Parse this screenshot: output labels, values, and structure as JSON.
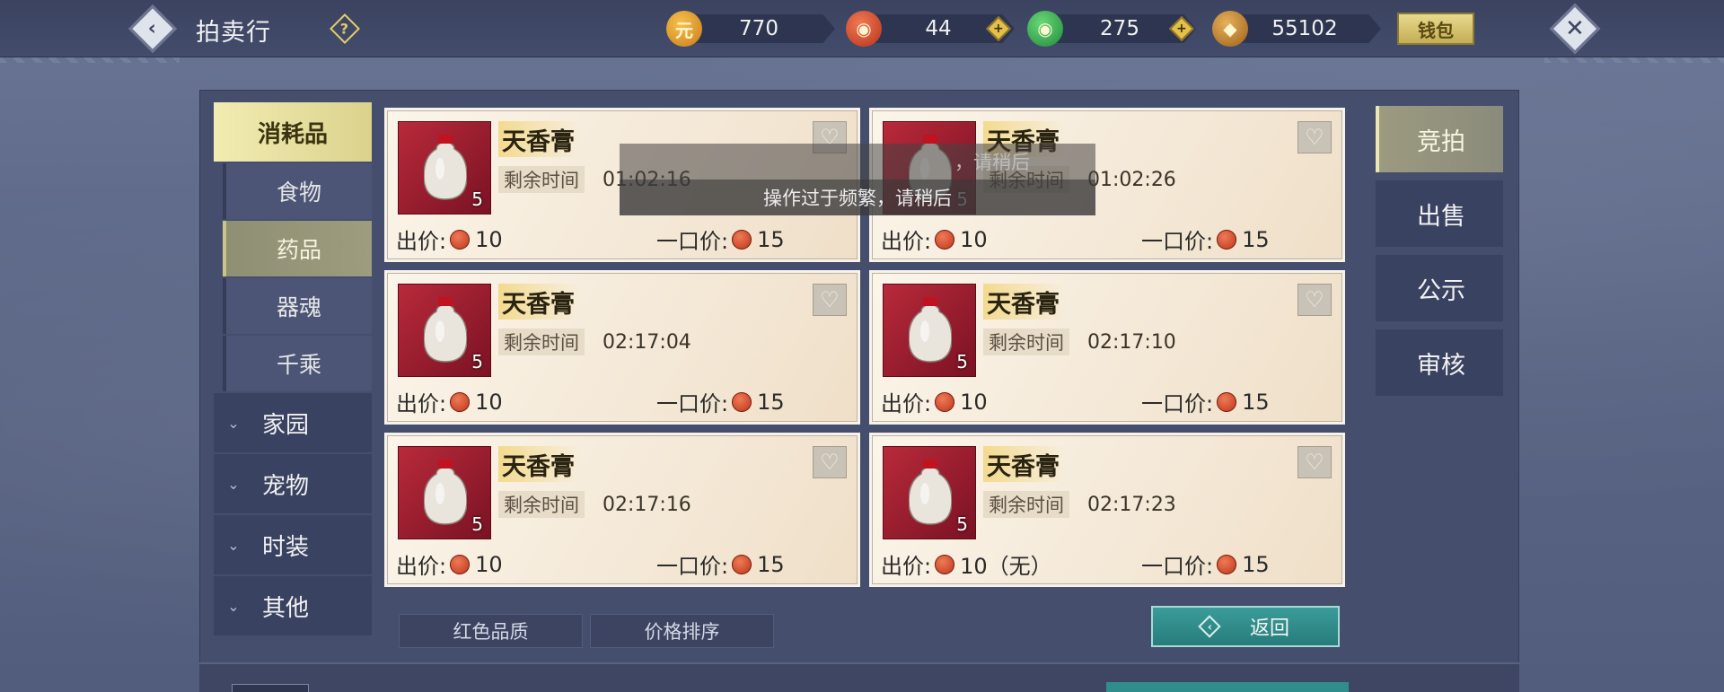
{
  "header": {
    "title": "拍卖行",
    "back_icon": "chevron-left-icon",
    "help_label": "?",
    "wallet_label": "钱包",
    "close_label": "✕"
  },
  "currencies": [
    {
      "name": "gold-ingot",
      "value": "770",
      "color": "#e0a032",
      "has_plus": false
    },
    {
      "name": "red-coin",
      "value": "44",
      "color": "#c9462b",
      "has_plus": true
    },
    {
      "name": "jade-coin",
      "value": "275",
      "color": "#2fa84f",
      "has_plus": true
    },
    {
      "name": "bronze-coin",
      "value": "55102",
      "color": "#b8782a",
      "has_plus": false
    }
  ],
  "categories": {
    "main_active": "消耗品",
    "subs": [
      "食物",
      "药品",
      "器魂",
      "千乘"
    ],
    "active_sub": "药品",
    "others": [
      "家园",
      "宠物",
      "时装",
      "其他"
    ]
  },
  "listings": [
    {
      "name": "天香膏",
      "time_label": "剩余时间",
      "time": "01:02:16",
      "bid_label": "出价:",
      "bid": "10",
      "buyout_label": "一口价:",
      "buyout": "15",
      "qty": "5"
    },
    {
      "name": "天香膏",
      "time_label": "剩余时间",
      "time": "01:02:26",
      "bid_label": "出价:",
      "bid": "10",
      "buyout_label": "一口价:",
      "buyout": "15",
      "qty": "5"
    },
    {
      "name": "天香膏",
      "time_label": "剩余时间",
      "time": "02:17:04",
      "bid_label": "出价:",
      "bid": "10",
      "buyout_label": "一口价:",
      "buyout": "15",
      "qty": "5"
    },
    {
      "name": "天香膏",
      "time_label": "剩余时间",
      "time": "02:17:10",
      "bid_label": "出价:",
      "bid": "10",
      "buyout_label": "一口价:",
      "buyout": "15",
      "qty": "5"
    },
    {
      "name": "天香膏",
      "time_label": "剩余时间",
      "time": "02:17:16",
      "bid_label": "出价:",
      "bid": "10",
      "buyout_label": "一口价:",
      "buyout": "15",
      "qty": "5"
    },
    {
      "name": "天香膏",
      "time_label": "剩余时间",
      "time": "02:17:23",
      "bid_label": "出价:",
      "bid": "10（无）",
      "buyout_label": "一口价:",
      "buyout": "15",
      "qty": "5"
    }
  ],
  "toasts": {
    "faded": "，请稍后",
    "main": "操作过于频繁，请稍后"
  },
  "filters": {
    "quality": "红色品质",
    "sort": "价格排序"
  },
  "return_label": "返回",
  "tabs": [
    "竞拍",
    "出售",
    "公示",
    "审核"
  ],
  "active_tab": "竞拍",
  "colors": {
    "accent_gold": "#e4cd6a",
    "teal_button": "#2f8e8c",
    "card_bg": "#f4e8d6",
    "item_red": "#b82a3a"
  }
}
